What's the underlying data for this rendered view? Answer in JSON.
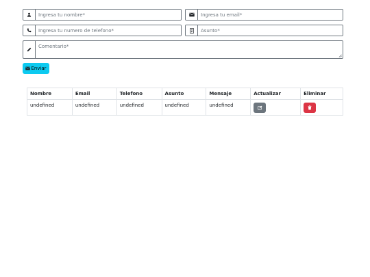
{
  "form": {
    "name_placeholder": "Ingresa tu nombre*",
    "email_placeholder": "Ingresa tu email*",
    "phone_placeholder": "Ingresa tu numero de telefono*",
    "subject_placeholder": "Asunto*",
    "comment_placeholder": "Comentario*",
    "submit_label": "Enviar",
    "icons": {
      "name": "user-icon",
      "email": "envelope-icon",
      "phone": "phone-icon",
      "subject": "file-text-icon",
      "comment": "pencil-icon",
      "submit": "envelope-icon"
    }
  },
  "table": {
    "headers": [
      "Nombre",
      "Email",
      "Telefono",
      "Asunto",
      "Mensaje",
      "Actualizar",
      "Eliminar"
    ],
    "rows": [
      {
        "nombre": "undefined",
        "email": "undefined",
        "telefono": "undefined",
        "asunto": "undefined",
        "mensaje": "undefined",
        "update_icon": "edit-icon",
        "delete_icon": "trash-icon"
      }
    ]
  },
  "colors": {
    "submit_button": "#0dcaf0",
    "update_button": "#6c757d",
    "delete_button": "#dc3545",
    "input_border": "#6c757d",
    "table_border": "#dee2e6"
  }
}
